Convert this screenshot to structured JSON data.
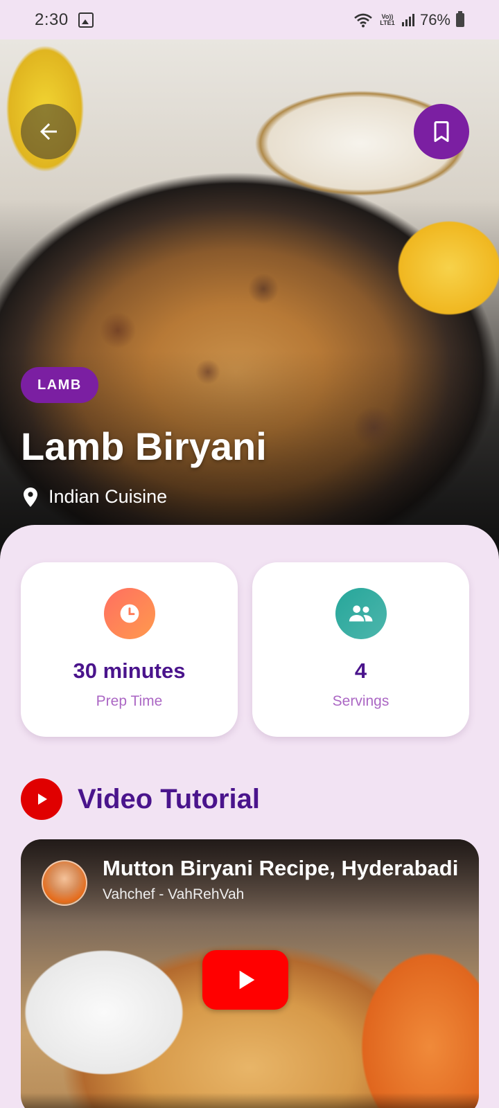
{
  "status_bar": {
    "time": "2:30",
    "volte": "Vo)) LTE1",
    "battery": "76%"
  },
  "hero": {
    "tag": "LAMB",
    "title": "Lamb Biryani",
    "cuisine": "Indian Cuisine"
  },
  "stats": {
    "prep": {
      "value": "30 minutes",
      "label": "Prep Time"
    },
    "servings": {
      "value": "4",
      "label": "Servings"
    }
  },
  "video_section": {
    "title": "Video Tutorial",
    "video_title": "Mutton Biryani Recipe, Hyderabadi",
    "channel": "Vahchef - VahRehVah"
  },
  "colors": {
    "accent": "#7b1fa2",
    "title_text": "#4a148c",
    "label_text": "#ab67c4",
    "background": "#f2e3f3",
    "youtube_red": "#ff0000"
  },
  "icons": [
    "gallery-icon",
    "wifi-icon",
    "signal-icon",
    "battery-icon",
    "arrow-back-icon",
    "bookmark-icon",
    "location-pin-icon",
    "clock-icon",
    "group-icon",
    "youtube-play-icon"
  ]
}
